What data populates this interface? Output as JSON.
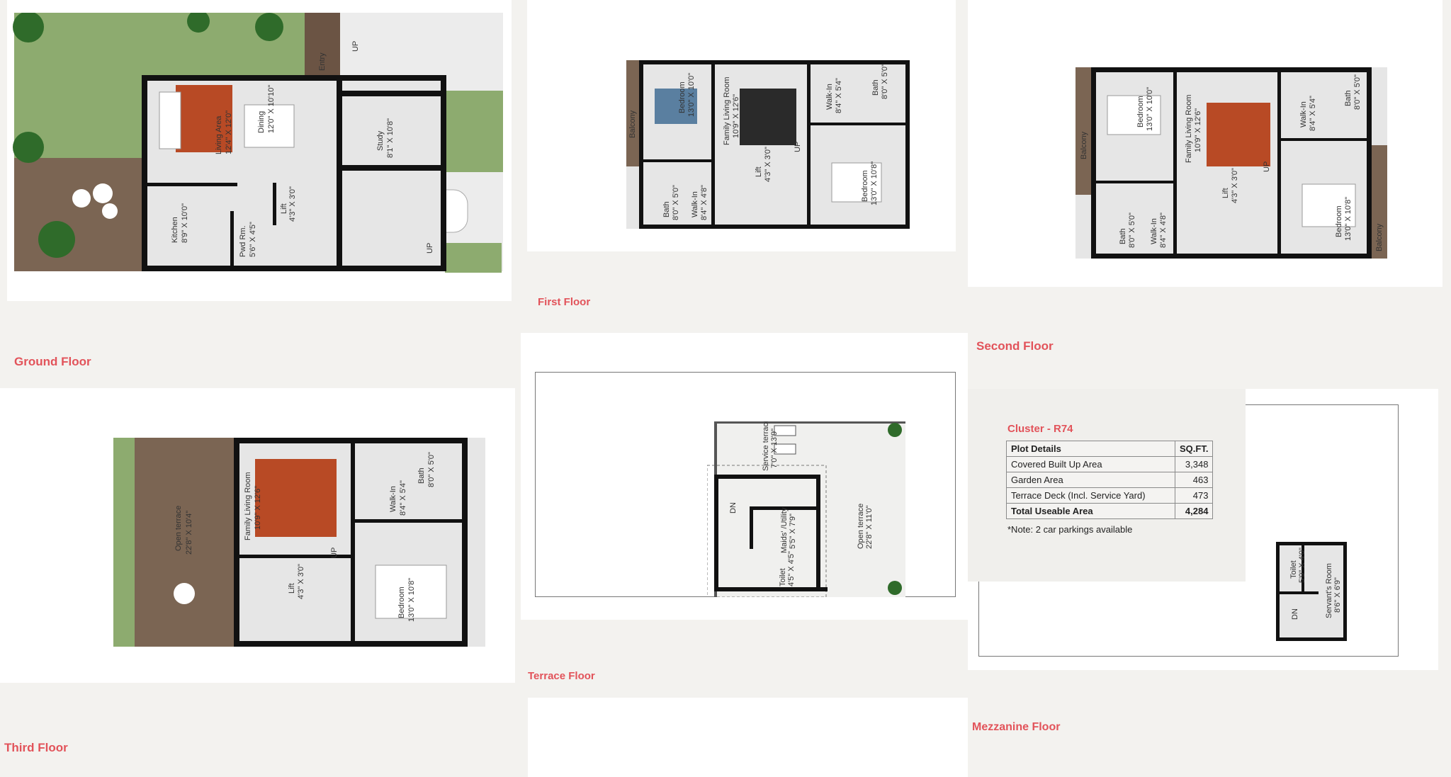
{
  "colors": {
    "accent": "#e2535a",
    "lawn": "#8dab6f",
    "deck": "#7b6553",
    "wall": "#111111",
    "floor": "#e6e6e6",
    "page": "#f3f2ef"
  },
  "captions": {
    "ground": "Ground Floor",
    "first": "First Floor",
    "second": "Second Floor",
    "third": "Third Floor",
    "terrace": "Terrace Floor",
    "mezzanine": "Mezzanine Floor"
  },
  "ground_plan": {
    "entry": "Entry",
    "up1": "UP",
    "up2": "UP",
    "living": "Living Area",
    "living_size": "12'4\" X 12'0\"",
    "dining": "Dining",
    "dining_size": "12'0\" X 10'10\"",
    "study": "Study",
    "study_size": "8'1\" X 10'8\"",
    "kitchen": "Kitchen",
    "kitchen_size": "8'9\" X 10'0\"",
    "pwd": "Pwd Rm.",
    "pwd_size": "5'6\" X 4'5\"",
    "lift": "Lift",
    "lift_size": "4'3\" X 3'0\""
  },
  "first_plan": {
    "balcony": "Balcony",
    "balcony_size": "15'4\" X 2'0\"",
    "bedroom1": "Bedroom",
    "bedroom1_size": "13'0\" X 10'0\"",
    "family": "Family Living Room",
    "family_size": "10'9\" X 12'6\"",
    "walkin1": "Walk-In",
    "walkin1_size": "8'4\" X 5'4\"",
    "bath1": "Bath",
    "bath1_size": "8'0\" X 5'0\"",
    "bath2": "Bath",
    "bath2_size": "8'0\" X 5'0\"",
    "walkin2": "Walk-In",
    "walkin2_size": "8'4\" X 4'8\"",
    "lift": "Lift",
    "lift_size": "4'3\" X 3'0\"",
    "bedroom2": "Bedroom",
    "bedroom2_size": "13'0\" X 10'8\"",
    "up": "UP"
  },
  "second_plan": {
    "balcony1": "Balcony",
    "balcony1_size": "15'4\" X 2'0\"",
    "bedroom1": "Bedroom",
    "bedroom1_size": "13'0\" X 10'0\"",
    "family": "Family Living Room",
    "family_size": "10'9\" X 12'6\"",
    "walkin1": "Walk-In",
    "walkin1_size": "8'4\" X 5'4\"",
    "bath1": "Bath",
    "bath1_size": "8'0\" X 5'0\"",
    "bath2": "Bath",
    "bath2_size": "8'0\" X 5'0\"",
    "walkin2": "Walk-In",
    "walkin2_size": "8'4\" X 4'8\"",
    "lift": "Lift",
    "lift_size": "4'3\" X 3'0\"",
    "bedroom2": "Bedroom",
    "bedroom2_size": "13'0\" X 10'8\"",
    "balcony2": "Balcony",
    "balcony2_size": "12'8\" X 2'0\"",
    "up": "UP"
  },
  "third_plan": {
    "terrace": "Open terrace",
    "terrace_size": "22'8\" X 10'4\"",
    "family": "Family Living Room",
    "family_size": "10'9\" X 12'6\"",
    "walkin": "Walk-In",
    "walkin_size": "8'4\" X 5'4\"",
    "bath": "Bath",
    "bath_size": "8'0\" X 5'0\"",
    "lift": "Lift",
    "lift_size": "4'3\" X 3'0\"",
    "bedroom": "Bedroom",
    "bedroom_size": "13'0\" X 10'8\"",
    "up": "UP"
  },
  "terrace_plan": {
    "service": "Service terrace",
    "service_size": "7'0\" X 13'9\"",
    "open": "Open terrace",
    "open_size": "22'8\" X 11'0\"",
    "dn": "DN",
    "maids": "Maids' /Utility",
    "maids_size": "5'5\" X 7'9\"",
    "toilet": "Toilet",
    "toilet_size": "4'5\" X 4'5\""
  },
  "mezz_plan": {
    "toilet": "Toilet",
    "toilet_size": "5'9\" X 4'0\"",
    "servant": "Servant's Room",
    "servant_size": "8'6\" X 6'9\"",
    "dn": "DN"
  },
  "cluster": {
    "title": "Cluster - R74",
    "header_name": "Plot Details",
    "header_value": "SQ.FT.",
    "rows": [
      {
        "name": "Covered Built Up Area",
        "value": "3,348"
      },
      {
        "name": "Garden Area",
        "value": "463"
      },
      {
        "name": "Terrace Deck (Incl. Service Yard)",
        "value": "473"
      }
    ],
    "total_name": "Total Useable Area",
    "total_value": "4,284",
    "note": "*Note: 2 car parkings available"
  }
}
